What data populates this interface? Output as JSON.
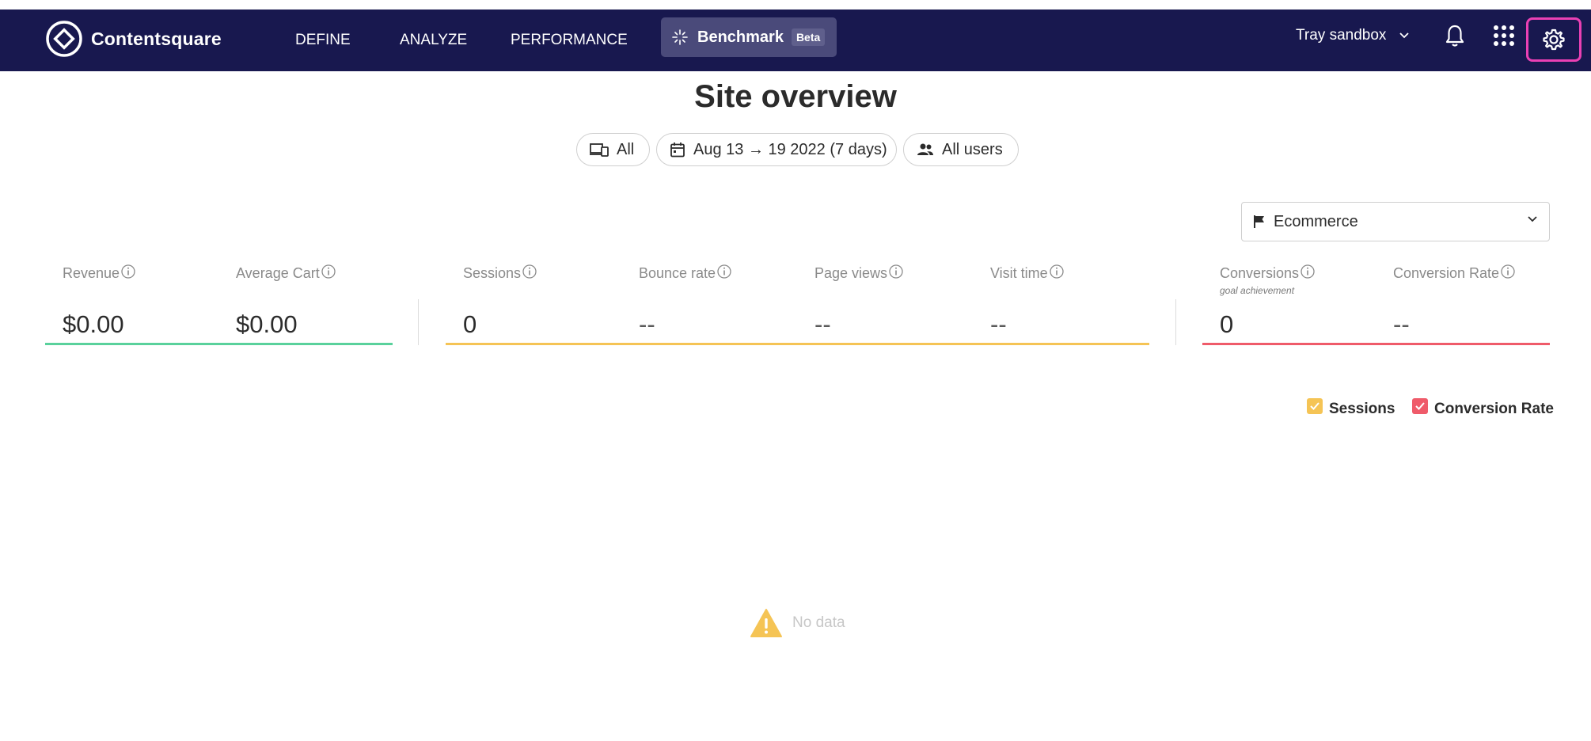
{
  "topbar": {
    "brand": "Contentsquare",
    "nav": [
      "DEFINE",
      "ANALYZE",
      "PERFORMANCE"
    ],
    "benchmark_label": "Benchmark",
    "benchmark_badge": "Beta",
    "workspace": "Tray sandbox",
    "colors": {
      "bar": "#18184f",
      "active": "#4a4a7a",
      "focus_ring": "#ea40b4"
    }
  },
  "page": {
    "title": "Site overview"
  },
  "filters": {
    "device": "All",
    "date_range": "Aug 13 → 19 2022 (7 days)",
    "segment": "All users"
  },
  "goal_selector": {
    "selected": "Ecommerce"
  },
  "metric_groups": [
    {
      "color": "#5ad19c",
      "metrics": [
        {
          "label": "Revenue",
          "value": "$0.00"
        },
        {
          "label": "Average Cart",
          "value": "$0.00"
        }
      ]
    },
    {
      "color": "#f5c455",
      "metrics": [
        {
          "label": "Sessions",
          "value": "0"
        },
        {
          "label": "Bounce rate",
          "value": "--"
        },
        {
          "label": "Page views",
          "value": "--"
        },
        {
          "label": "Visit time",
          "value": "--"
        }
      ]
    },
    {
      "color": "#ef5b6a",
      "metrics": [
        {
          "label": "Conversions",
          "sublabel": "goal achievement",
          "value": "0"
        },
        {
          "label": "Conversion Rate",
          "value": "--"
        }
      ]
    }
  ],
  "legend": [
    {
      "label": "Sessions",
      "color": "#f5c455",
      "checked": true
    },
    {
      "label": "Conversion Rate",
      "color": "#ef5b6a",
      "checked": true
    }
  ],
  "chart_empty": {
    "message": "No data",
    "icon": "warning-icon",
    "color": "#f5c455"
  }
}
